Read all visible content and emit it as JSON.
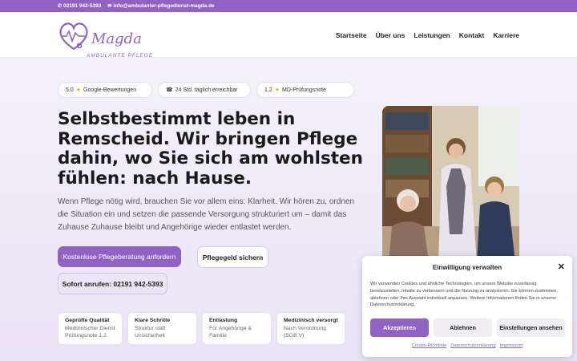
{
  "topbar": {
    "phone": "02191 942-5393",
    "email": "info@ambulanter-pflegedienst-magda.de",
    "phone_icon": "phone-icon",
    "email_icon": "mail-icon"
  },
  "brand": {
    "name": "Magda",
    "tagline": "AMBULANTE PFLEGE"
  },
  "nav": {
    "items": [
      "Startseite",
      "Über uns",
      "Leistungen",
      "Kontakt",
      "Karriere"
    ]
  },
  "badges": [
    {
      "text_pre": "5,0",
      "star": "★",
      "text": "Google-Bewertungen"
    },
    {
      "icon": "☎",
      "text": "24 Std. täglich erreichbar"
    },
    {
      "text_pre": "1,2",
      "star": "★",
      "text": "MD-Prüfungsnote"
    }
  ],
  "hero": {
    "title": "Selbstbestimmt leben in Remscheid. Wir bringen Pflege dahin, wo Sie sich am wohlsten fühlen: nach Hause.",
    "lead": "Wenn Pflege nötig wird, brauchen Sie vor allem eins: Klarheit. Wir hören zu, ordnen die Situation ein und setzen die passende Versorgung strukturiert um – damit das Zuhause Zuhause bleibt und Angehörige wieder entlastet werden.",
    "cta_primary": "Kostenlose Pflegeberatung anfordern",
    "cta_secondary": "Pflegegeld sichern",
    "cta_phone": "Sofort anrufen: 02191 942-5393"
  },
  "features": [
    {
      "title": "Geprüfte Qualität",
      "line1": "Medizinischer Dienst",
      "line2": "Prüfungsnote 1,2"
    },
    {
      "title": "Klare Schritte",
      "line1": "Struktur statt",
      "line2": "Unsicherheit"
    },
    {
      "title": "Entlastung",
      "line1": "Für Angehörige &",
      "line2": "Familie"
    },
    {
      "title": "Medizinisch versorgt",
      "line1": "Nach Verordnung",
      "line2": "(SGB V)"
    }
  ],
  "consent": {
    "title": "Einwilligung verwalten",
    "text": "Wir verwenden Cookies und ähnliche Technologien, um unsere Website zuverlässig bereitzustellen, Inhalte zu verbessern und die Nutzung zu analysieren. Sie können zustimmen, ablehnen oder Ihre Auswahl individuell anpassen. Weitere Informationen finden Sie in unserer Datenschutzerklärung.",
    "accept": "Akzeptieren",
    "deny": "Ablehnen",
    "settings": "Einstellungen ansehen",
    "links": [
      "Cookie-Richtlinie",
      "Datenschutzerklärung",
      "Impressum"
    ]
  },
  "colors": {
    "accent": "#8f62c4",
    "star": "#f0b400"
  }
}
